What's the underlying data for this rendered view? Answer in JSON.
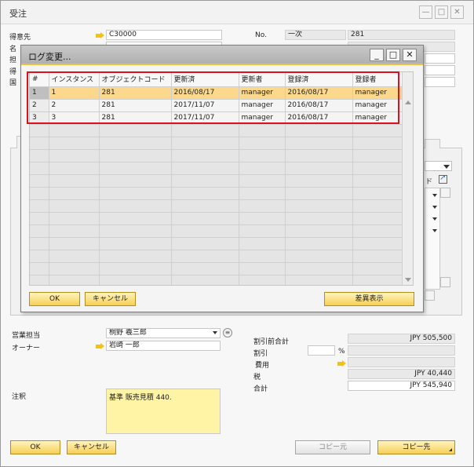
{
  "window": {
    "title": "受注",
    "min_icon": "minimize-icon",
    "max_icon": "maximize-icon",
    "close_icon": "close-icon"
  },
  "header": {
    "customer_label": "得意先",
    "customer_value": "C30000",
    "partial_labels": [
      "名",
      "担",
      "得",
      "国"
    ],
    "no_label": "No.",
    "series_value": "一次",
    "doc_number": "281"
  },
  "dialog": {
    "title": "ログ変更...",
    "columns": [
      "#",
      "インスタンス",
      "オブジェクトコード",
      "更新済",
      "更新者",
      "登録済",
      "登録者"
    ],
    "rows": [
      [
        "1",
        "1",
        "281",
        "2016/08/17",
        "manager",
        "2016/08/17",
        "manager"
      ],
      [
        "2",
        "2",
        "281",
        "2017/11/07",
        "manager",
        "2016/08/17",
        "manager"
      ],
      [
        "3",
        "3",
        "281",
        "2017/11/07",
        "manager",
        "2016/08/17",
        "manager"
      ]
    ],
    "ok_label": "OK",
    "cancel_label": "キャンセル",
    "diff_label": "差異表示"
  },
  "side": {
    "partial_label": "ド"
  },
  "footer_left": {
    "sales_rep_label": "営業担当",
    "sales_rep_value": "桐野 羲三郎",
    "owner_label": "オーナー",
    "owner_value": "岩崎 一郎",
    "remarks_label": "注釈",
    "remarks_value": "基準 販売見積 440."
  },
  "totals": {
    "subtotal_label": "割引前合計",
    "subtotal_value": "JPY 505,500",
    "discount_label": "割引",
    "percent_sign": "%",
    "freight_label": "費用",
    "tax_label": "税",
    "tax_value": "JPY 40,440",
    "total_label": "合計",
    "total_value": "JPY 545,940"
  },
  "buttons": {
    "ok": "OK",
    "cancel": "キャンセル",
    "copy_from": "コピー元",
    "copy_to": "コピー先"
  },
  "colors": {
    "accent": "#f6cf54",
    "selected_row": "#fcd88d",
    "highlight_box": "#e0101f"
  }
}
